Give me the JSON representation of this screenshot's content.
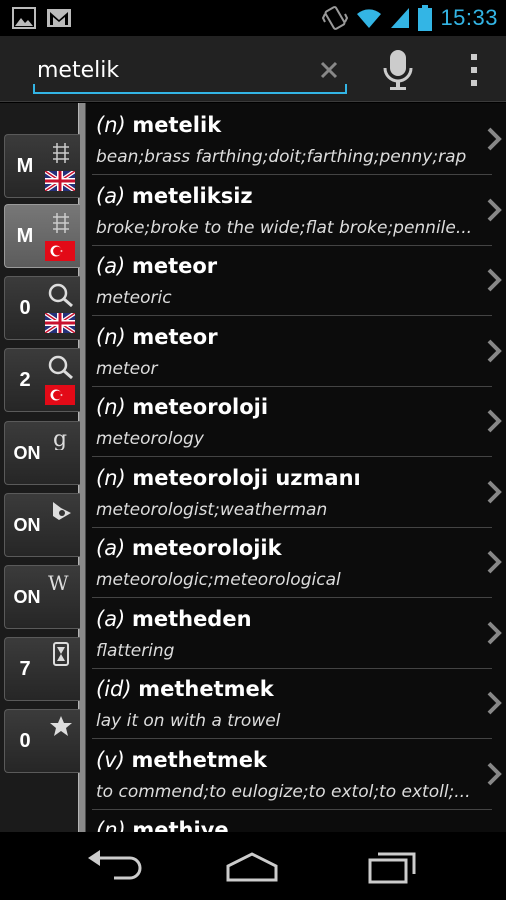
{
  "status_bar": {
    "time": "15:33",
    "left_icons": [
      "image-icon",
      "gmail-icon"
    ],
    "right_icons": [
      "vibrate-icon",
      "wifi-icon",
      "signal-icon",
      "battery-icon"
    ],
    "accent": "#33b5e5"
  },
  "search": {
    "value": "metelik",
    "placeholder": ""
  },
  "sidebar": {
    "buttons": [
      {
        "label": "M",
        "icon": "tuning-fork-icon",
        "flag": "uk-flag-icon",
        "active": false
      },
      {
        "label": "M",
        "icon": "tuning-fork-icon",
        "flag": "turkey-flag-icon",
        "active": true
      },
      {
        "label": "0",
        "icon": "magnifier-icon",
        "flag": "uk-flag-icon",
        "active": false
      },
      {
        "label": "2",
        "icon": "magnifier-icon",
        "flag": "turkey-flag-icon",
        "active": false
      },
      {
        "label": "ON",
        "icon": "google-icon",
        "flag": "",
        "active": false
      },
      {
        "label": "ON",
        "icon": "bing-icon",
        "flag": "",
        "active": false
      },
      {
        "label": "ON",
        "icon": "wikipedia-icon",
        "flag": "",
        "active": false
      },
      {
        "label": "7",
        "icon": "hourglass-icon",
        "flag": "",
        "active": false
      },
      {
        "label": "0",
        "icon": "star-icon",
        "flag": "",
        "active": false
      }
    ]
  },
  "results": [
    {
      "pos": "(n)",
      "word": "metelik",
      "translation": "bean;brass farthing;doit;farthing;penny;rap"
    },
    {
      "pos": "(a)",
      "word": "meteliksiz",
      "translation": "broke;broke to the wide;flat broke;pennile..."
    },
    {
      "pos": "(a)",
      "word": "meteor",
      "translation": "meteoric"
    },
    {
      "pos": "(n)",
      "word": "meteor",
      "translation": "meteor"
    },
    {
      "pos": "(n)",
      "word": "meteoroloji",
      "translation": "meteorology"
    },
    {
      "pos": "(n)",
      "word": "meteoroloji uzmanı",
      "translation": "meteorologist;weatherman"
    },
    {
      "pos": "(a)",
      "word": "meteorolojik",
      "translation": "meteorologic;meteorological"
    },
    {
      "pos": "(a)",
      "word": "metheden",
      "translation": "flattering"
    },
    {
      "pos": "(id)",
      "word": "methetmek",
      "translation": "lay it on with a trowel"
    },
    {
      "pos": "(v)",
      "word": "methetmek",
      "translation": "to commend;to eulogize;to extol;to extoll;..."
    },
    {
      "pos": "(n)",
      "word": "methiye",
      "translation": ""
    }
  ],
  "nav": [
    "back-icon",
    "home-icon",
    "recent-apps-icon"
  ]
}
